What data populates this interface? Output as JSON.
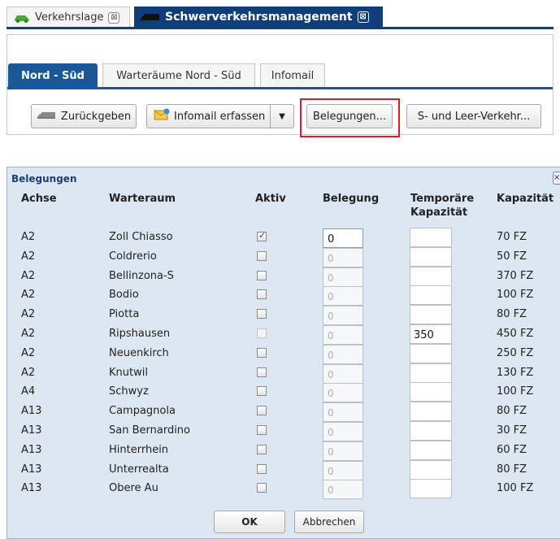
{
  "app_tabs": [
    {
      "label": "Verkehrslage",
      "icon": "car-icon",
      "close": "⊠"
    },
    {
      "label": "Schwerverkehrsmanagement",
      "icon": "truck-icon",
      "close": "⊠"
    }
  ],
  "sub_tabs": [
    "Nord - Süd",
    "Warteräume Nord - Süd",
    "Infomail"
  ],
  "toolbar": {
    "return_label": "Zurückgeben",
    "infomail_label": "Infomail erfassen",
    "belegungen_label": "Belegungen...",
    "sverkehr_label": "S- und Leer-Verkehr..."
  },
  "dialog": {
    "title": "Belegungen",
    "close": "×",
    "headers": {
      "achse": "Achse",
      "warteraum": "Warteraum",
      "aktiv": "Aktiv",
      "belegung": "Belegung",
      "temp_line1": "Temporäre",
      "temp_line2": "Kapazität",
      "kapazitaet": "Kapazität"
    },
    "rows": [
      {
        "achse": "A2",
        "warteraum": "Zoll Chiasso",
        "aktiv": true,
        "disabled": false,
        "belegung": "0",
        "temp": "",
        "kapazitaet": "70 FZ"
      },
      {
        "achse": "A2",
        "warteraum": "Coldrerio",
        "aktiv": false,
        "disabled": false,
        "belegung": "0",
        "temp": "",
        "kapazitaet": "50 FZ"
      },
      {
        "achse": "A2",
        "warteraum": "Bellinzona-S",
        "aktiv": false,
        "disabled": false,
        "belegung": "0",
        "temp": "",
        "kapazitaet": "370 FZ"
      },
      {
        "achse": "A2",
        "warteraum": "Bodio",
        "aktiv": false,
        "disabled": false,
        "belegung": "0",
        "temp": "",
        "kapazitaet": "100 FZ"
      },
      {
        "achse": "A2",
        "warteraum": "Piotta",
        "aktiv": false,
        "disabled": false,
        "belegung": "0",
        "temp": "",
        "kapazitaet": "80 FZ"
      },
      {
        "achse": "A2",
        "warteraum": "Ripshausen",
        "aktiv": false,
        "disabled": true,
        "belegung": "0",
        "temp": "350",
        "kapazitaet": "450 FZ"
      },
      {
        "achse": "A2",
        "warteraum": "Neuenkirch",
        "aktiv": false,
        "disabled": false,
        "belegung": "0",
        "temp": "",
        "kapazitaet": "250 FZ"
      },
      {
        "achse": "A2",
        "warteraum": "Knutwil",
        "aktiv": false,
        "disabled": false,
        "belegung": "0",
        "temp": "",
        "kapazitaet": "130 FZ"
      },
      {
        "achse": "A4",
        "warteraum": "Schwyz",
        "aktiv": false,
        "disabled": false,
        "belegung": "0",
        "temp": "",
        "kapazitaet": "100 FZ"
      },
      {
        "achse": "A13",
        "warteraum": "Campagnola",
        "aktiv": false,
        "disabled": false,
        "belegung": "0",
        "temp": "",
        "kapazitaet": "80 FZ"
      },
      {
        "achse": "A13",
        "warteraum": "San Bernardino",
        "aktiv": false,
        "disabled": false,
        "belegung": "0",
        "temp": "",
        "kapazitaet": "30 FZ"
      },
      {
        "achse": "A13",
        "warteraum": "Hinterrhein",
        "aktiv": false,
        "disabled": false,
        "belegung": "0",
        "temp": "",
        "kapazitaet": "60 FZ"
      },
      {
        "achse": "A13",
        "warteraum": "Unterrealta",
        "aktiv": false,
        "disabled": false,
        "belegung": "0",
        "temp": "",
        "kapazitaet": "80 FZ"
      },
      {
        "achse": "A13",
        "warteraum": "Obere Au",
        "aktiv": false,
        "disabled": false,
        "belegung": "0",
        "temp": "",
        "kapazitaet": "100 FZ"
      }
    ],
    "ok_label": "OK",
    "cancel_label": "Abbrechen"
  },
  "colors": {
    "brand": "#0f3e7a",
    "subtab_active": "#1a5796",
    "highlight": "#e11c25",
    "dialog_bg": "#dde7f2"
  }
}
